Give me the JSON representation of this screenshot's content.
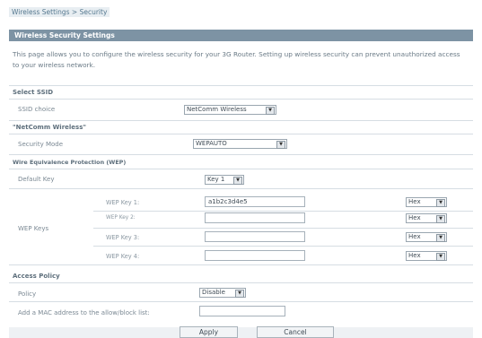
{
  "breadcrumb": "Wireless Settings > Security",
  "header": {
    "title": "Wireless Security Settings"
  },
  "description": "This page allows you to configure the wireless security for your 3G Router. Setting up wireless security can prevent unauthorized access to your wireless network.",
  "ssid_section": {
    "title": "Select SSID",
    "choice_label": "SSID choice",
    "choice_value": "NetComm Wireless"
  },
  "network_section": {
    "title": "\"NetComm Wireless\"",
    "security_mode_label": "Security Mode",
    "security_mode_value": "WEPAUTO"
  },
  "wep_section": {
    "title": "Wire Equivalence Protection (WEP)",
    "default_key_label": "Default Key",
    "default_key_value": "Key 1",
    "keys_label": "WEP Keys",
    "keys": [
      {
        "label": "WEP Key 1:",
        "value": "a1b2c3d4e5",
        "format": "Hex"
      },
      {
        "label": "WEP Key 2:",
        "value": "",
        "format": "Hex"
      },
      {
        "label": "WEP Key 3:",
        "value": "",
        "format": "Hex"
      },
      {
        "label": "WEP Key 4:",
        "value": "",
        "format": "Hex"
      }
    ]
  },
  "access_section": {
    "title": "Access Policy",
    "policy_label": "Policy",
    "policy_value": "Disable",
    "mac_label": "Add a MAC address to the allow/block list:",
    "mac_value": ""
  },
  "buttons": {
    "apply": "Apply",
    "cancel": "Cancel"
  }
}
